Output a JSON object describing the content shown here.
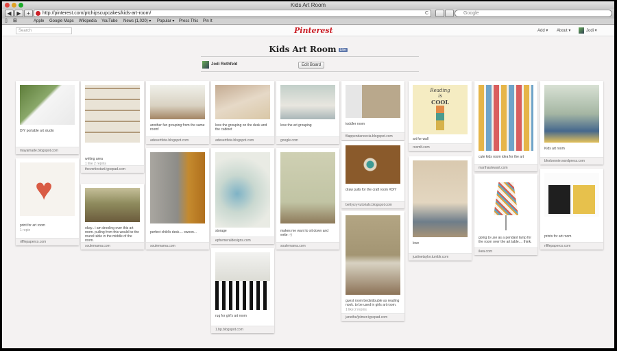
{
  "window": {
    "title": "Kids Art Room"
  },
  "toolbar": {
    "url": "http://pinterest.com/ptchipscupcakes/kids-art-room/",
    "search_placeholder": "Google",
    "back": "◀",
    "forward": "▶",
    "add": "+",
    "reload": "C"
  },
  "bookmarks": [
    "Apple",
    "Google Maps",
    "Wikipedia",
    "YouTube",
    "News (1,020) ▾",
    "Popular ▾",
    "Press This",
    "Pin It"
  ],
  "nav": {
    "search_placeholder": "Search",
    "logo": "Pinterest",
    "add": "Add ▾",
    "about": "About ▾",
    "user": "Jodi ▾"
  },
  "board": {
    "title": "Kids Art Room",
    "like": "Like",
    "owner": "Jodi Rothfeld",
    "edit_button": "Edit Board"
  },
  "pins": [
    {
      "desc": "DIY portable art studio",
      "stats": "",
      "source": "mayamade.blogspot.com"
    },
    {
      "desc": "print for art room",
      "stats": "1 repin",
      "source": "rifflepaperco.com"
    },
    {
      "desc": "writing area",
      "stats": "1 like   2 repins",
      "source": "thevertiestart.typepad.com"
    },
    {
      "desc": "okay.. i am drooling over this art room. pulling from this would be the round table in the middle of the room.",
      "stats": "",
      "source": "soulemama.com"
    },
    {
      "desc": "another fun grouping from the same room!",
      "stats": "",
      "source": "adesertfete.blogspot.com"
    },
    {
      "desc": "perfect child's desk.... swoon...",
      "stats": "",
      "source": "soulemama.com"
    },
    {
      "desc": "love the grouping on the desk and the cabinet",
      "stats": "",
      "source": "adesertfete.blogspot.com"
    },
    {
      "desc": "storage",
      "stats": "",
      "source": "ephemeraldesigns.com"
    },
    {
      "desc": "rug for girl's art room",
      "stats": "",
      "source": "1.bp.blogspot.com"
    },
    {
      "desc": "love the art grouping",
      "stats": "",
      "source": "google.com"
    },
    {
      "desc": "makes me want to sit down and write :-)",
      "stats": "",
      "source": "soulemama.com"
    },
    {
      "desc": "toddler room",
      "stats": "",
      "source": "filappendancecia.blogspot.com"
    },
    {
      "desc": "draw pulls for the craft room #DIY",
      "stats": "",
      "source": "bettycry-tutorials.blogspot.com"
    },
    {
      "desc": "guest room beds/double as reading nook. to be used in girls art room.",
      "stats": "1 like   2 repins",
      "source": "janethe/jolmer.typepad.com"
    },
    {
      "desc": "art for wall",
      "stats": "",
      "source": "roomlt.com"
    },
    {
      "desc": "love",
      "stats": "",
      "source": "justinetaylor.tumblr.com"
    },
    {
      "desc": "cute kids room idea for the art",
      "stats": "",
      "source": "marthastewart.com"
    },
    {
      "desc": "going to use as a pendant lamp for the room over the art table.... think.",
      "stats": "",
      "source": "ikea.com"
    },
    {
      "desc": "Kids art room",
      "stats": "",
      "source": "bforbonnie.wordpress.com"
    },
    {
      "desc": "prints for art room",
      "stats": "",
      "source": "rifflepaperco.com"
    }
  ],
  "poster": {
    "line1": "Reading",
    "line2": "is",
    "line3": "COOL"
  }
}
